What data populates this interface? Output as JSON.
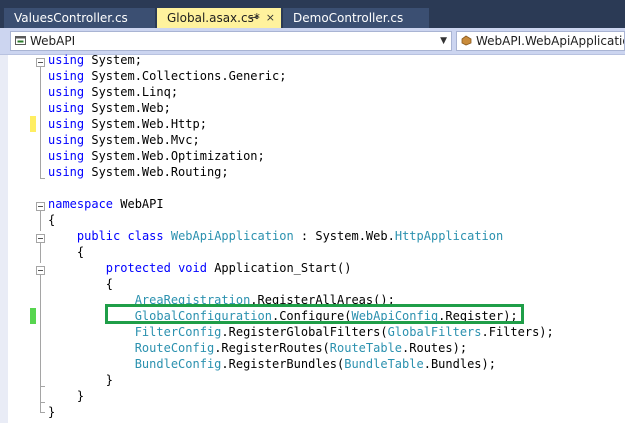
{
  "tabs": [
    {
      "label": "ValuesController.cs",
      "active": false
    },
    {
      "label": "Global.asax.cs*",
      "active": true,
      "pin": "⊸",
      "close": "×"
    },
    {
      "label": "DemoController.cs",
      "active": false
    }
  ],
  "navigation": {
    "project_dropdown": "WebAPI",
    "class_dropdown": "WebAPI.WebApiApplication"
  },
  "icons": {
    "project": "csharp-project-icon",
    "class": "class-icon",
    "pin": "pin-icon",
    "close": "close-icon"
  },
  "colors": {
    "keyword": "#0000ff",
    "type": "#2b91af",
    "highlight_box": "#1f9e48",
    "change_unsaved": "#ffee62",
    "change_saved": "#57d54f"
  },
  "code": {
    "lines": [
      {
        "segments": [
          {
            "t": "using",
            "c": "kw"
          },
          {
            "t": " System;"
          }
        ]
      },
      {
        "segments": [
          {
            "t": "using",
            "c": "kw"
          },
          {
            "t": " System.Collections.Generic;"
          }
        ]
      },
      {
        "segments": [
          {
            "t": "using",
            "c": "kw"
          },
          {
            "t": " System.Linq;"
          }
        ]
      },
      {
        "segments": [
          {
            "t": "using",
            "c": "kw"
          },
          {
            "t": " System.Web;"
          }
        ]
      },
      {
        "segments": [
          {
            "t": "using",
            "c": "kw"
          },
          {
            "t": " System.Web.Http;"
          }
        ]
      },
      {
        "segments": [
          {
            "t": "using",
            "c": "kw"
          },
          {
            "t": " System.Web.Mvc;"
          }
        ]
      },
      {
        "segments": [
          {
            "t": "using",
            "c": "kw"
          },
          {
            "t": " System.Web.Optimization;"
          }
        ]
      },
      {
        "segments": [
          {
            "t": "using",
            "c": "kw"
          },
          {
            "t": " System.Web.Routing;"
          }
        ]
      },
      {
        "segments": []
      },
      {
        "segments": [
          {
            "t": "namespace",
            "c": "kw"
          },
          {
            "t": " WebAPI"
          }
        ]
      },
      {
        "segments": [
          {
            "t": "{"
          }
        ]
      },
      {
        "segments": [
          {
            "t": "    "
          },
          {
            "t": "public",
            "c": "kw"
          },
          {
            "t": " "
          },
          {
            "t": "class",
            "c": "kw"
          },
          {
            "t": " "
          },
          {
            "t": "WebApiApplication",
            "c": "ty"
          },
          {
            "t": " : System.Web."
          },
          {
            "t": "HttpApplication",
            "c": "ty"
          }
        ]
      },
      {
        "segments": [
          {
            "t": "    {"
          }
        ]
      },
      {
        "segments": [
          {
            "t": "        "
          },
          {
            "t": "protected",
            "c": "kw"
          },
          {
            "t": " "
          },
          {
            "t": "void",
            "c": "kw"
          },
          {
            "t": " Application_Start()"
          }
        ]
      },
      {
        "segments": [
          {
            "t": "        {"
          }
        ]
      },
      {
        "segments": [
          {
            "t": "            "
          },
          {
            "t": "AreaRegistration",
            "c": "ty"
          },
          {
            "t": ".RegisterAllAreas();"
          }
        ]
      },
      {
        "segments": [
          {
            "t": "            "
          },
          {
            "t": "GlobalConfiguration",
            "c": "ty"
          },
          {
            "t": ".Configure("
          },
          {
            "t": "WebApiConfig",
            "c": "ty"
          },
          {
            "t": ".Register);"
          }
        ]
      },
      {
        "segments": [
          {
            "t": "            "
          },
          {
            "t": "FilterConfig",
            "c": "ty"
          },
          {
            "t": ".RegisterGlobalFilters("
          },
          {
            "t": "GlobalFilters",
            "c": "ty"
          },
          {
            "t": ".Filters);"
          }
        ]
      },
      {
        "segments": [
          {
            "t": "            "
          },
          {
            "t": "RouteConfig",
            "c": "ty"
          },
          {
            "t": ".RegisterRoutes("
          },
          {
            "t": "RouteTable",
            "c": "ty"
          },
          {
            "t": ".Routes);"
          }
        ]
      },
      {
        "segments": [
          {
            "t": "            "
          },
          {
            "t": "BundleConfig",
            "c": "ty"
          },
          {
            "t": ".RegisterBundles("
          },
          {
            "t": "BundleTable",
            "c": "ty"
          },
          {
            "t": ".Bundles);"
          }
        ]
      },
      {
        "segments": [
          {
            "t": "        }"
          }
        ]
      },
      {
        "segments": [
          {
            "t": "    }"
          }
        ]
      },
      {
        "segments": [
          {
            "t": "}"
          }
        ]
      }
    ]
  }
}
